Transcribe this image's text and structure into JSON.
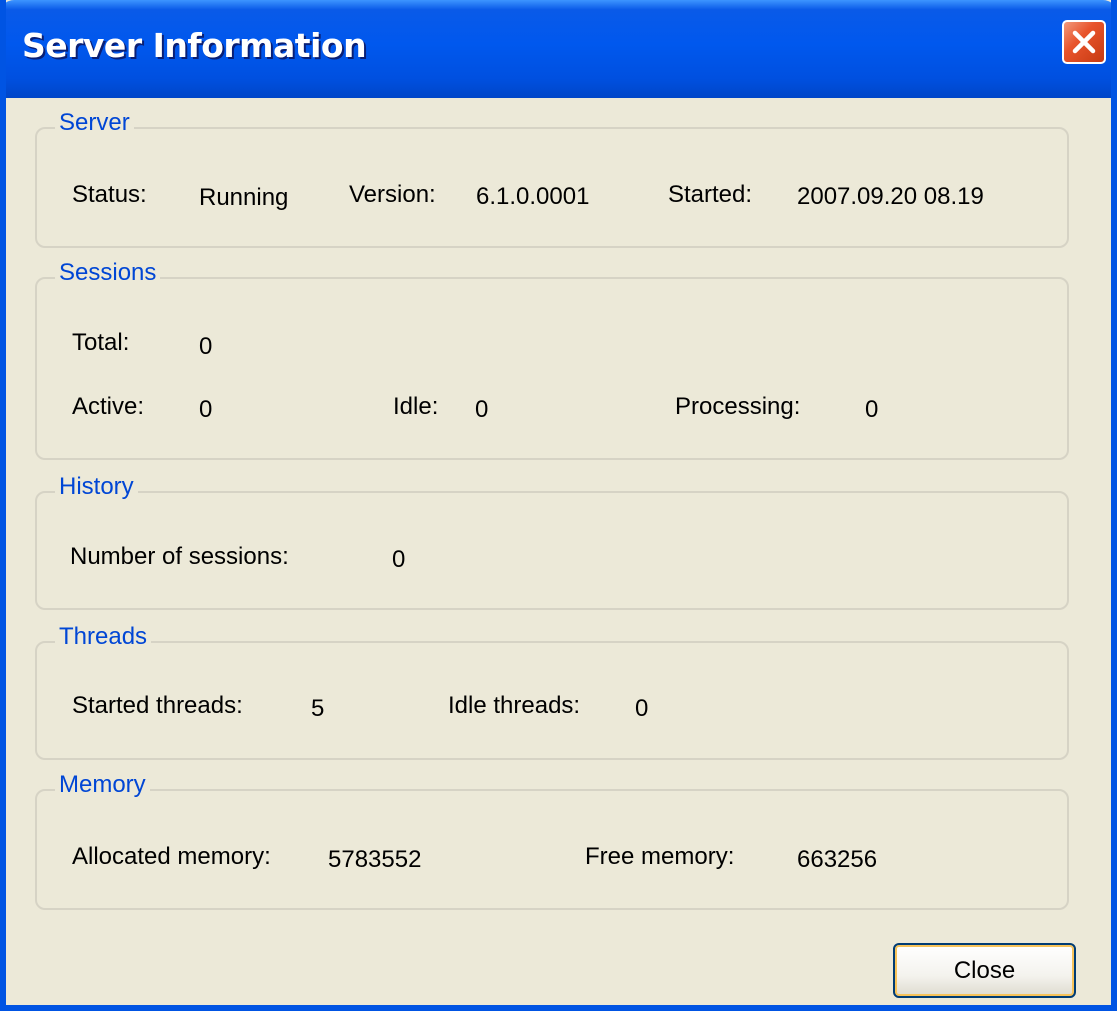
{
  "window": {
    "title": "Server Information",
    "close_icon": "close-icon"
  },
  "server": {
    "legend": "Server",
    "status_label": "Status:",
    "status_value": "Running",
    "version_label": "Version:",
    "version_value": "6.1.0.0001",
    "started_label": "Started:",
    "started_value": "2007.09.20 08.19"
  },
  "sessions": {
    "legend": "Sessions",
    "total_label": "Total:",
    "total_value": "0",
    "active_label": "Active:",
    "active_value": "0",
    "idle_label": "Idle:",
    "idle_value": "0",
    "processing_label": "Processing:",
    "processing_value": "0"
  },
  "history": {
    "legend": "History",
    "num_sessions_label": "Number of sessions:",
    "num_sessions_value": "0"
  },
  "threads": {
    "legend": "Threads",
    "started_label": "Started threads:",
    "started_value": "5",
    "idle_label": "Idle threads:",
    "idle_value": "0"
  },
  "memory": {
    "legend": "Memory",
    "allocated_label": "Allocated memory:",
    "allocated_value": "5783552",
    "free_label": "Free memory:",
    "free_value": "663256"
  },
  "footer": {
    "close_label": "Close"
  }
}
